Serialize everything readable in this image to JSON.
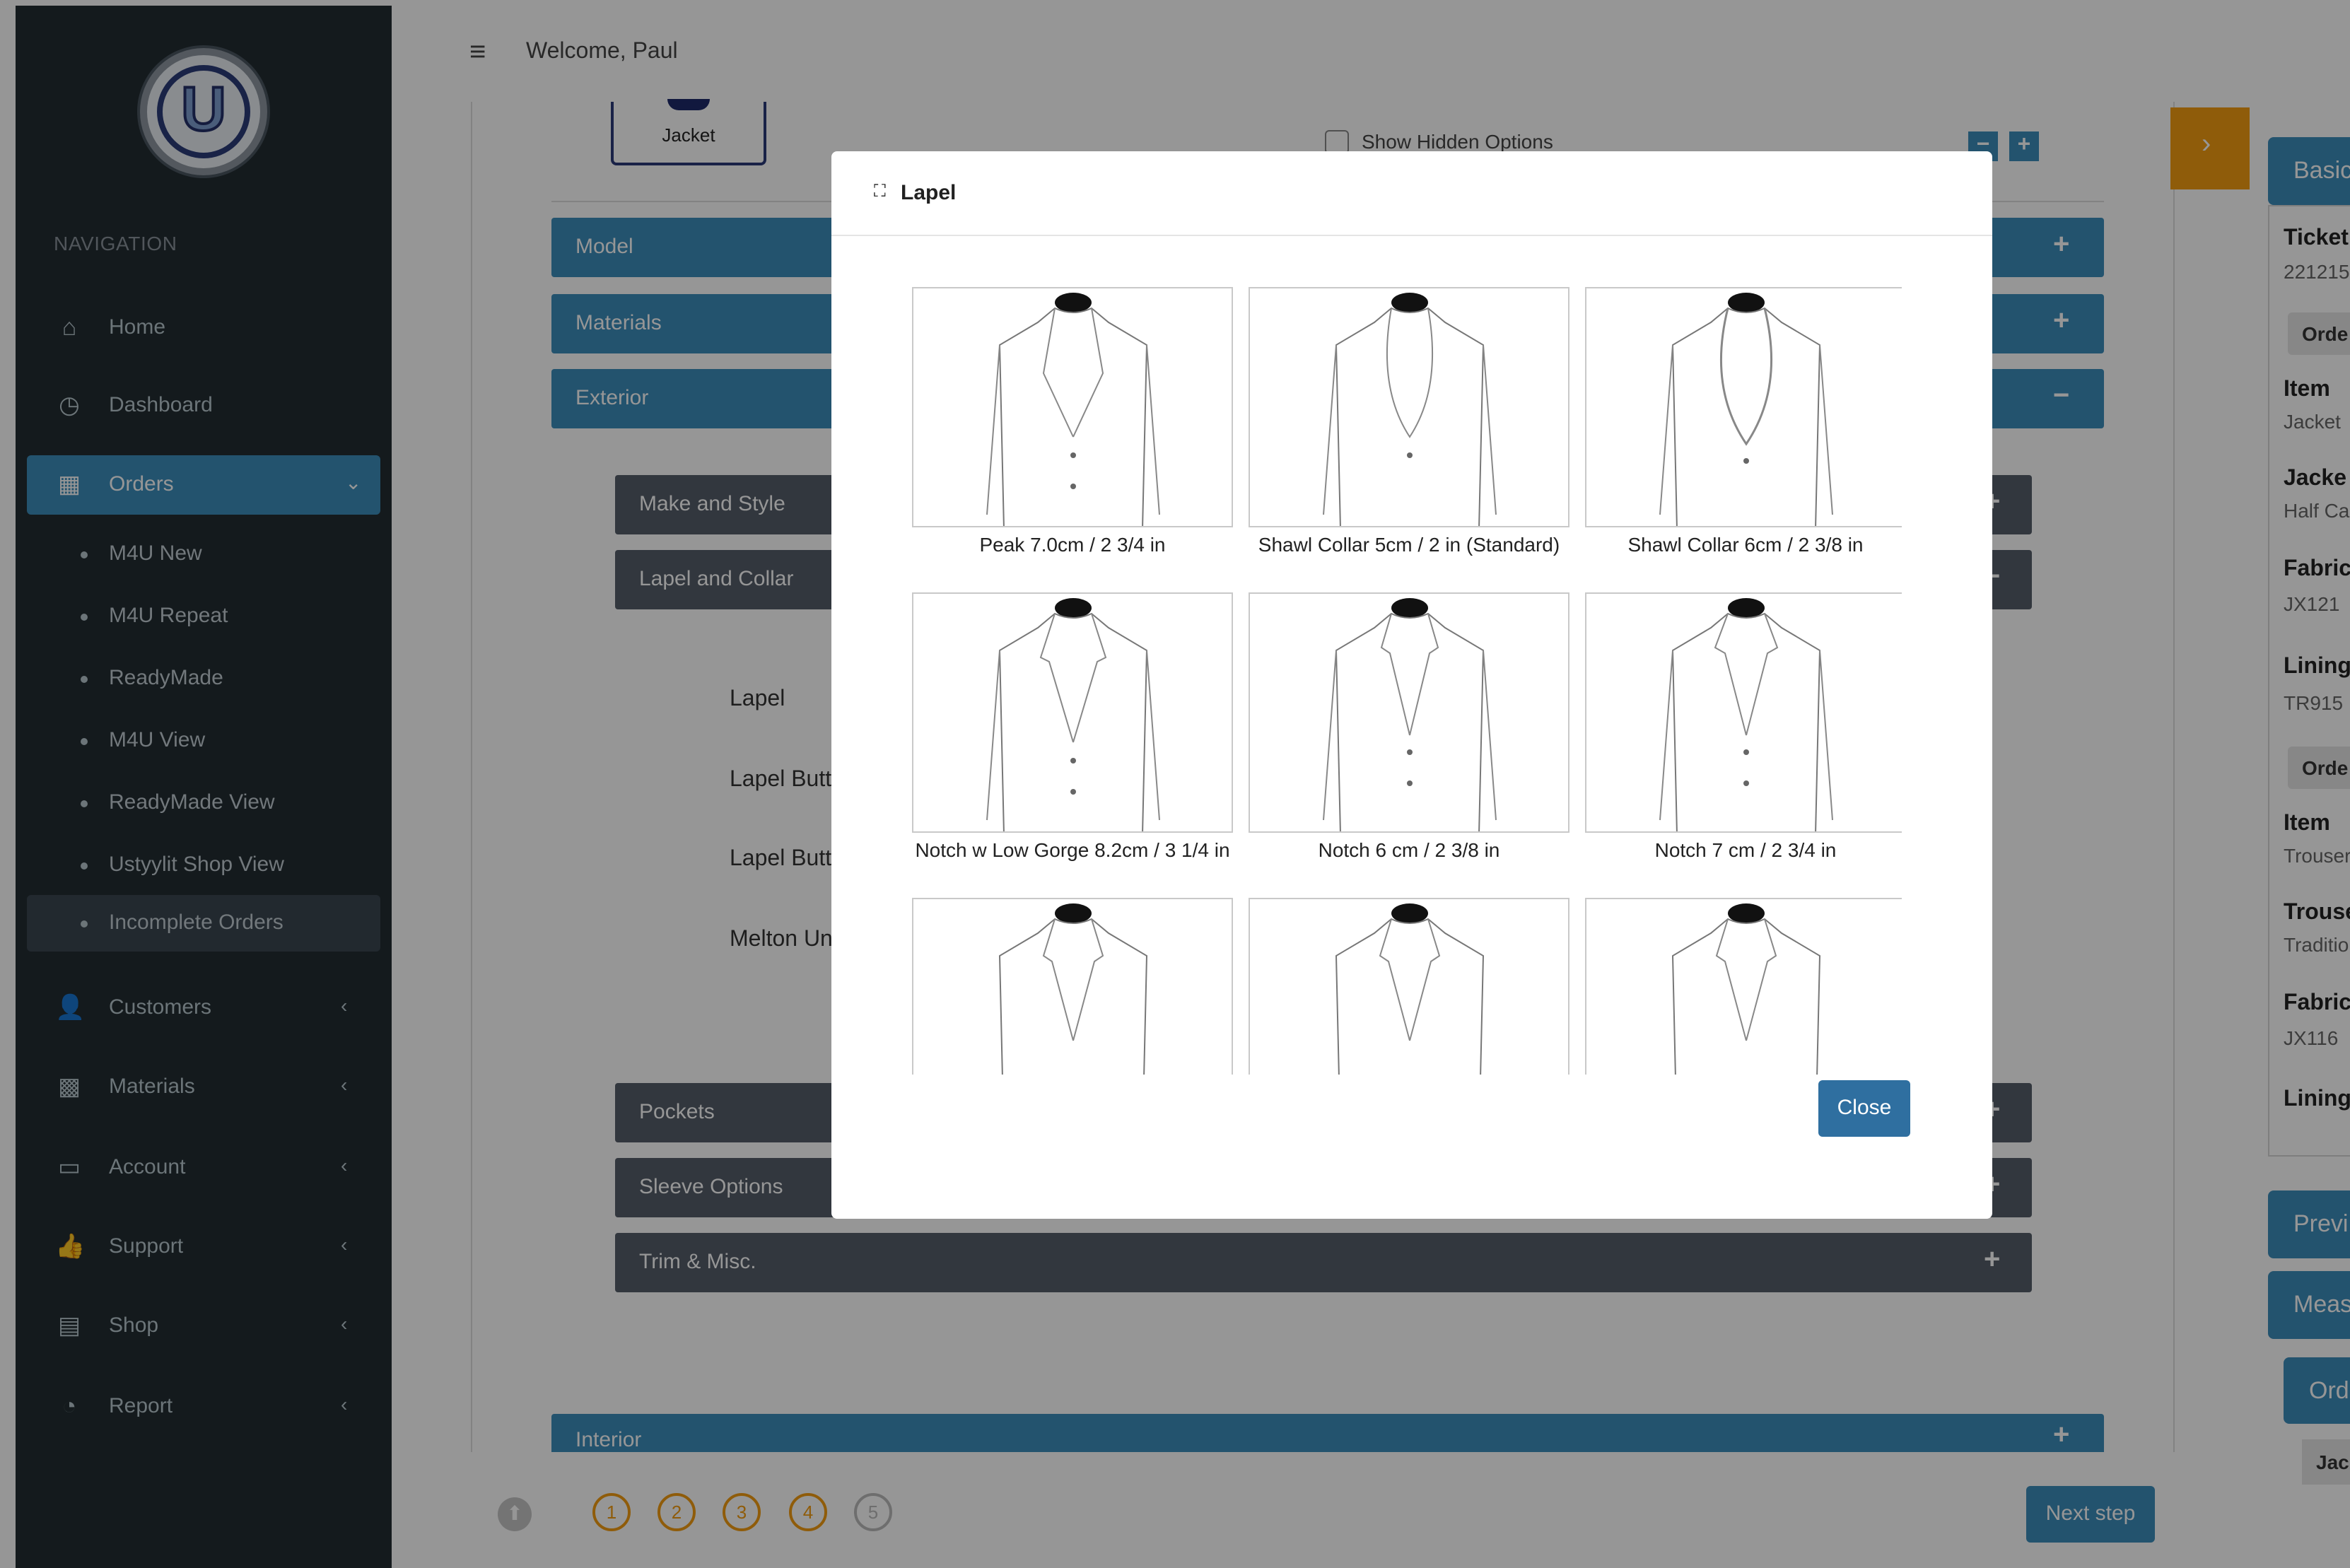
{
  "topbar": {
    "welcome": "Welcome, Paul"
  },
  "sidebar": {
    "nav_header": "NAVIGATION",
    "items": [
      {
        "label": "Home",
        "icon": "home-icon"
      },
      {
        "label": "Dashboard",
        "icon": "dashboard-icon"
      },
      {
        "label": "Orders",
        "icon": "clipboard-icon"
      },
      {
        "label": "Customers",
        "icon": "users-icon"
      },
      {
        "label": "Materials",
        "icon": "materials-icon"
      },
      {
        "label": "Account",
        "icon": "wallet-icon"
      },
      {
        "label": "Support",
        "icon": "thumbs-up-icon"
      },
      {
        "label": "Shop",
        "icon": "shop-icon"
      },
      {
        "label": "Report",
        "icon": "pie-chart-icon"
      }
    ],
    "orders_sub": [
      "M4U New",
      "M4U Repeat",
      "ReadyMade",
      "M4U View",
      "ReadyMade View",
      "Ustyylit Shop View",
      "Incomplete Orders"
    ]
  },
  "main": {
    "jacket_tab": "Jacket",
    "show_hidden_label": "Show Hidden Options",
    "panels": {
      "model": "Model",
      "materials": "Materials",
      "exterior": "Exterior",
      "interior": "Interior"
    },
    "subpanels": {
      "make_style": "Make and Style",
      "lapel_collar": "Lapel and Collar",
      "pockets": "Pockets",
      "sleeve": "Sleeve Options",
      "trim": "Trim & Misc."
    },
    "field_labels": [
      "Lapel",
      "Lapel Butt",
      "Lapel Butt",
      "Melton Un"
    ],
    "steps": [
      "1",
      "2",
      "3",
      "4",
      "5"
    ],
    "next_step": "Next step"
  },
  "modal": {
    "title": "Lapel",
    "options": [
      "Peak 7.0cm / 2 3/4 in",
      "Shawl Collar 5cm / 2 in (Standard)",
      "Shawl Collar 6cm / 2 3/8 in",
      "Notch w Low Gorge 8.2cm / 3 1/4 in",
      "Notch 6 cm / 2 3/8 in",
      "Notch 7 cm / 2 3/4 in"
    ],
    "close_label": "Close"
  },
  "right": {
    "basic_tab": "Basic",
    "ticket_label": "Ticket",
    "ticket_value": "221215",
    "order1": "Orde",
    "item1_label": "Item",
    "item1_value": "Jacket",
    "jacket_label": "Jacke",
    "jacket_value": "Half Ca",
    "fabric1_label": "Fabric",
    "fabric1_value": "JX121",
    "lining1_label": "Lining",
    "lining1_value": "TR915",
    "order2": "Orde",
    "item2_label": "Item",
    "item2_value": "Trouser",
    "trouser_label": "Trouse",
    "trouser_value": "Traditio",
    "fabric2_label": "Fabric",
    "fabric2_value": "JX116",
    "lining2_label": "Lining",
    "preview_tab": "Previ",
    "measure_tab": "Meas",
    "order_tab": "Orde",
    "jac_tab": "Jac"
  }
}
